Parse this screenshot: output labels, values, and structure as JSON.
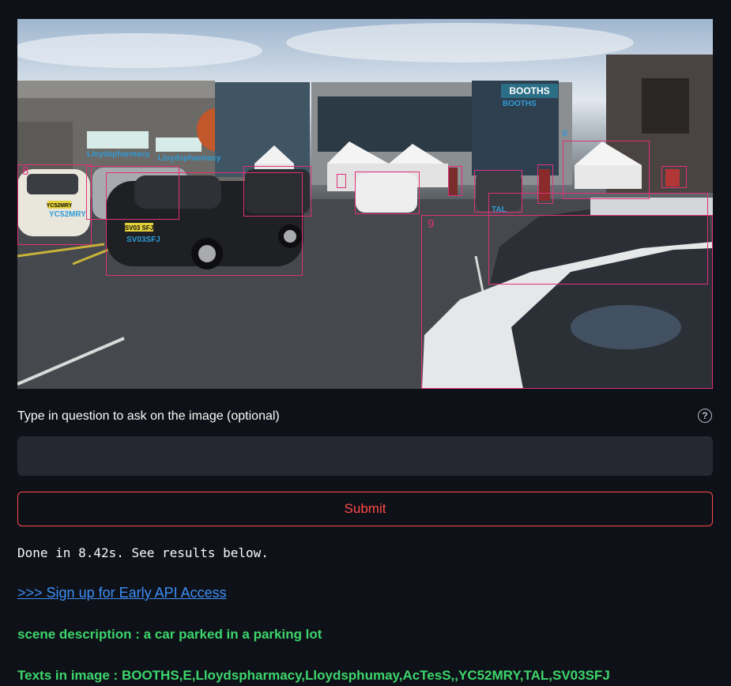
{
  "scene": {
    "store_sign": "BOOTHS",
    "detections": [
      {
        "number": "8"
      },
      {
        "number": "9"
      }
    ],
    "ocr_labels": {
      "booths": "BOOTHS",
      "lloyds_1": "Lloydspharmacy",
      "lloyds_2": "Lloydspharmacy",
      "yc52": "YC52MRY",
      "plate_yc52": "YC52MRY",
      "sv03": "SV03SFJ",
      "plate_sv03": "SV03 SFJ",
      "tal": "TAL",
      "e": "E"
    },
    "colors": {
      "box": "#e0307a",
      "ocr_text": "#2f9bd6"
    }
  },
  "question": {
    "label": "Type in question to ask on the image (optional)",
    "value": "",
    "help_icon": "?"
  },
  "submit": {
    "label": "Submit"
  },
  "results": {
    "status": "Done in 8.42s. See results below.",
    "api_link": ">>> Sign up for Early API Access",
    "scene_description": "scene description : a car parked in a parking lot",
    "texts_in_image": "Texts in image : BOOTHS,E,Lloydspharmacy,Lloydsphumay,AcTesS,,YC52MRY,TAL,SV03SFJ"
  },
  "theme": {
    "background": "#0e1117",
    "input": "#262730",
    "accent": "#ff4b4b",
    "link": "#3d8ef5",
    "success": "#3dd56d"
  }
}
